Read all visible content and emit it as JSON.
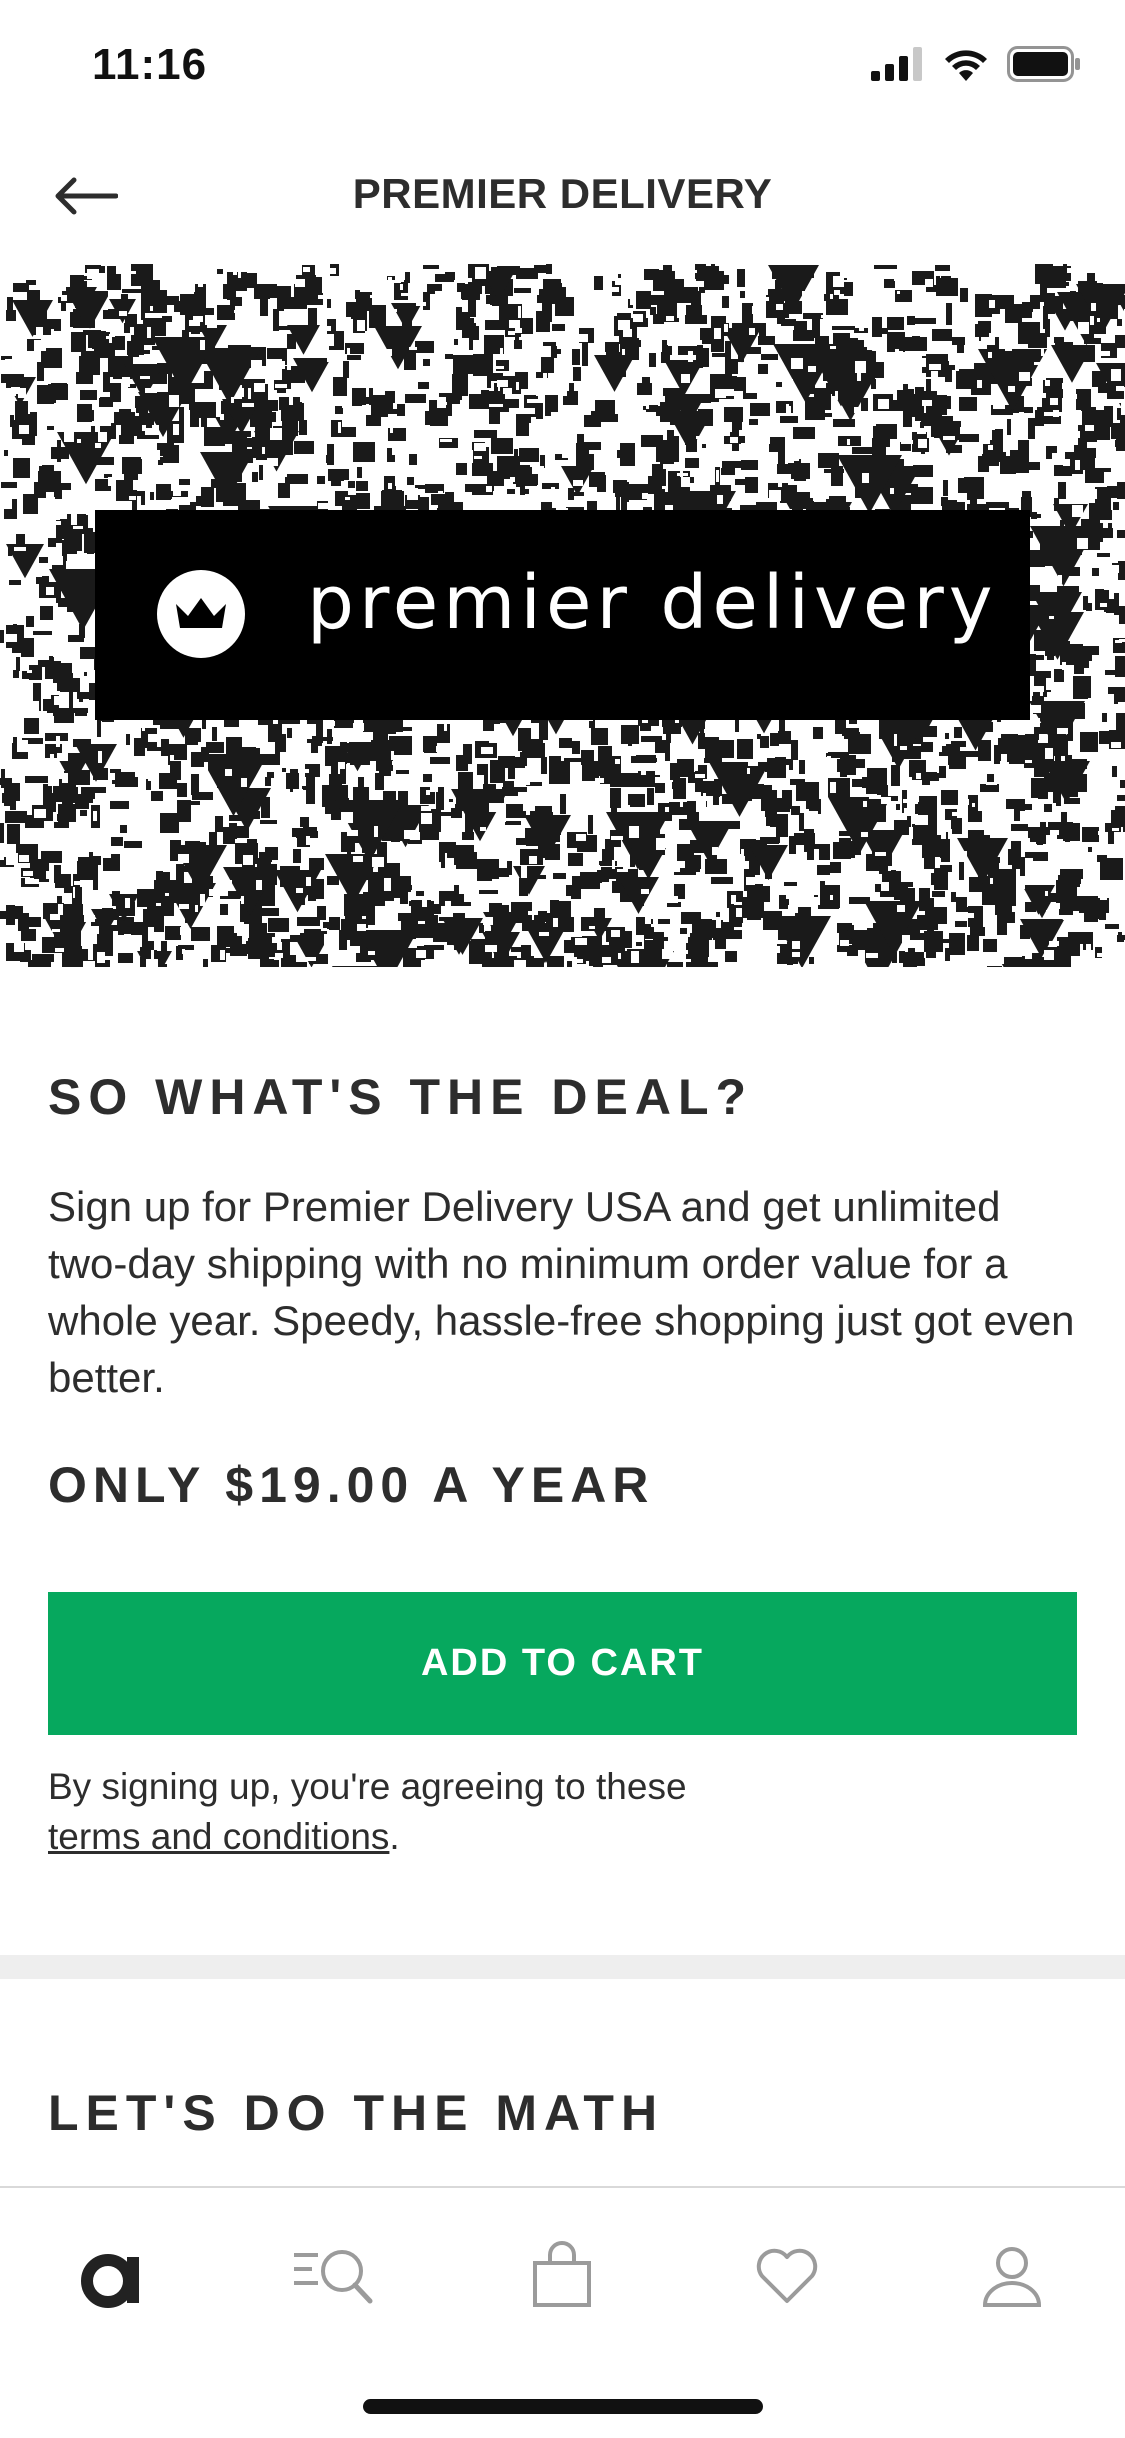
{
  "status_bar": {
    "time": "11:16",
    "icons": [
      "signal-icon",
      "wifi-icon",
      "battery-icon"
    ]
  },
  "header": {
    "title": "PREMIER DELIVERY",
    "back_icon": "arrow-left-icon"
  },
  "banner": {
    "text": "premier delivery",
    "logo_icon": "crown-icon"
  },
  "deal": {
    "heading": "SO WHAT'S THE DEAL?",
    "body": "Sign up for Premier Delivery USA and get unlimited two-day shipping with no minimum order value for a whole year. Speedy, hassle-free shopping just got even better.",
    "price": "ONLY $19.00 A YEAR",
    "add_to_cart_label": "ADD TO CART",
    "terms_prefix": "By signing up, you're agreeing to these",
    "terms_link": "terms and conditions",
    "terms_suffix": "."
  },
  "math": {
    "heading": "LET'S DO THE MATH"
  },
  "bottom_nav": {
    "items": [
      {
        "icon": "home-a-icon",
        "active": true
      },
      {
        "icon": "search-icon",
        "active": false
      },
      {
        "icon": "bag-icon",
        "active": false
      },
      {
        "icon": "heart-icon",
        "active": false
      },
      {
        "icon": "profile-icon",
        "active": false
      }
    ]
  },
  "colors": {
    "primary_button": "#06a85e",
    "text": "#2d2d2d",
    "divider": "#eeeeee",
    "inactive_icon": "#9b9b9b"
  }
}
